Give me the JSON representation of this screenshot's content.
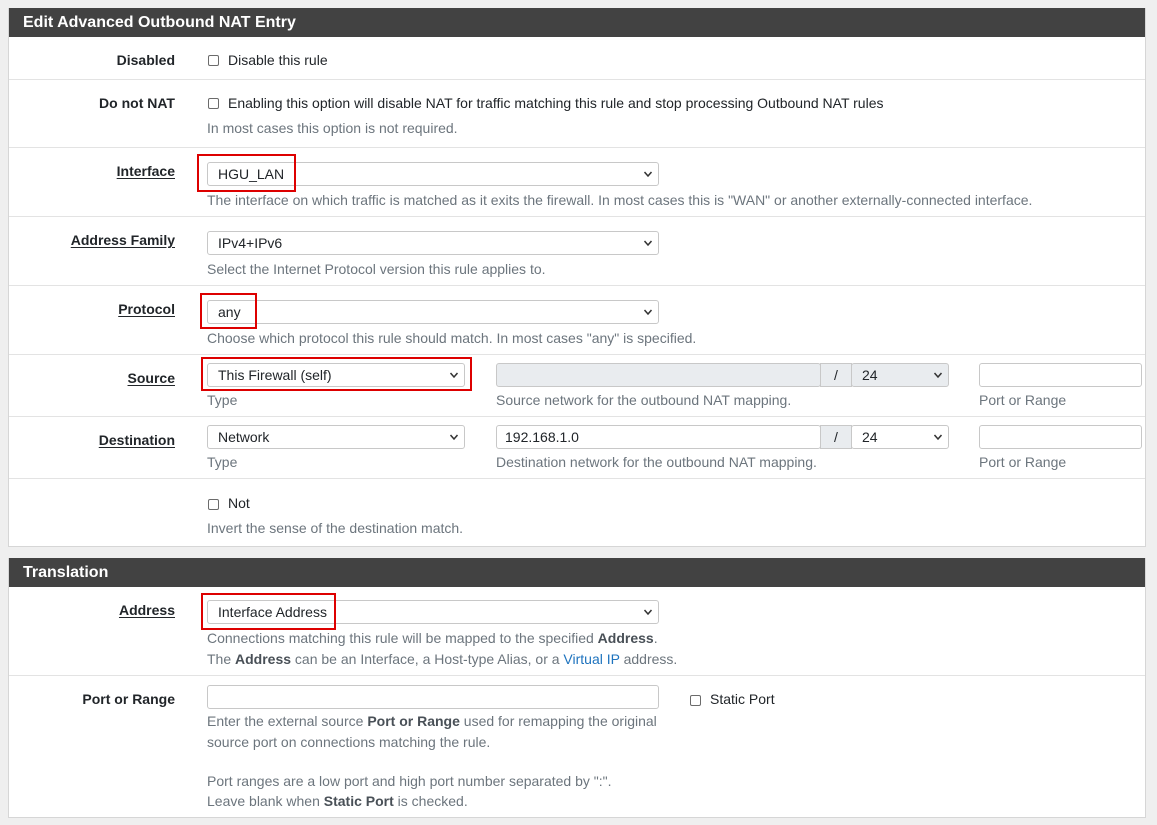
{
  "section1": {
    "title": "Edit Advanced Outbound NAT Entry",
    "disabled": {
      "label": "Disabled",
      "checkbox_label": "Disable this rule"
    },
    "do_not_nat": {
      "label": "Do not NAT",
      "checkbox_label": "Enabling this option will disable NAT for traffic matching this rule and stop processing Outbound NAT rules",
      "help": "In most cases this option is not required."
    },
    "interface": {
      "label": "Interface",
      "value": "HGU_LAN",
      "help": "The interface on which traffic is matched as it exits the firewall. In most cases this is \"WAN\" or another externally-connected interface."
    },
    "address_family": {
      "label": "Address Family",
      "value": "IPv4+IPv6",
      "help": "Select the Internet Protocol version this rule applies to."
    },
    "protocol": {
      "label": "Protocol",
      "value": "any",
      "help": "Choose which protocol this rule should match. In most cases \"any\" is specified."
    },
    "source": {
      "label": "Source",
      "type_value": "This Firewall (self)",
      "type_help": "Type",
      "network_value": "",
      "slash": "/",
      "mask": "24",
      "network_help": "Source network for the outbound NAT mapping.",
      "port_value": "",
      "port_help": "Port or Range"
    },
    "destination": {
      "label": "Destination",
      "type_value": "Network",
      "type_help": "Type",
      "network_value": "192.168.1.0",
      "slash": "/",
      "mask": "24",
      "network_help": "Destination network for the outbound NAT mapping.",
      "port_value": "",
      "port_help": "Port or Range"
    },
    "not": {
      "checkbox_label": "Not",
      "help": "Invert the sense of the destination match."
    }
  },
  "section2": {
    "title": "Translation",
    "address": {
      "label": "Address",
      "value": "Interface Address",
      "help1_pre": "Connections matching this rule will be mapped to the specified ",
      "help1_bold": "Address",
      "help1_post": ".",
      "help2_pre": "The ",
      "help2_bold": "Address",
      "help2_mid": " can be an Interface, a Host-type Alias, or a ",
      "help2_link": "Virtual IP",
      "help2_post": " address."
    },
    "port_or_range": {
      "label": "Port or Range",
      "value": "",
      "static_port_label": "Static Port",
      "help1_pre": "Enter the external source ",
      "help1_bold": "Port or Range",
      "help1_post": " used for remapping the original",
      "help2": "source port on connections matching the rule.",
      "help3": "Port ranges are a low port and high port number separated by \":\".",
      "help4_pre": "Leave blank when ",
      "help4_bold": "Static Port",
      "help4_post": " is checked."
    }
  },
  "colors": {
    "heading_bg": "#424242",
    "highlight": "#dd0000",
    "link": "#1e73be"
  },
  "icons": {
    "select_arrow": "chevron-down-icon"
  }
}
